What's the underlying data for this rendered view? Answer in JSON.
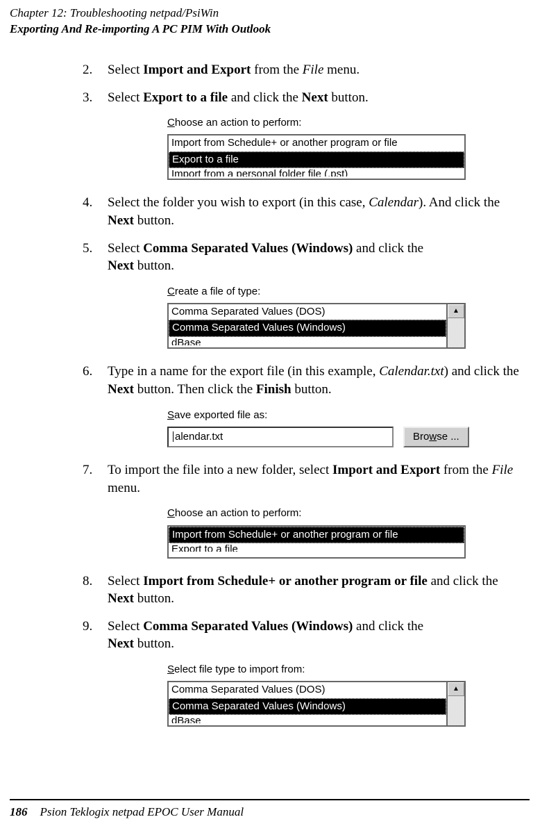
{
  "header": {
    "chapter": "Chapter 12:  Troubleshooting netpad/PsiWin",
    "section": "Exporting And Re-importing A PC PIM With Outlook"
  },
  "steps": {
    "s2": {
      "num": "2.",
      "pre": "Select ",
      "b1": "Import and Export",
      "mid": " from the ",
      "i1": "File",
      "post": " menu."
    },
    "s3": {
      "num": "3.",
      "pre": "Select ",
      "b1": "Export to a file",
      "mid": " and click the ",
      "b2": "Next",
      "post": " button."
    },
    "s4": {
      "num": "4.",
      "pre": "Select the folder you wish to export (in this case, ",
      "i1": "Calendar",
      "mid": "). And click the ",
      "b1": "Next",
      "post": " button."
    },
    "s5": {
      "num": "5.",
      "pre": "Select ",
      "b1": "Comma Separated Values (Windows)",
      "mid": " and click the ",
      "b2": "Next",
      "post": " button."
    },
    "s6": {
      "num": "6.",
      "pre": "Type in a name for the export file (in this example, ",
      "i1": "Calendar.txt",
      "mid": ") and click the ",
      "b1": "Next",
      "mid2": " button. Then click the ",
      "b2": "Finish",
      "post": " button."
    },
    "s7": {
      "num": "7.",
      "pre": "To import the file into a new folder, select ",
      "b1": "Import and Export",
      "mid": " from the ",
      "i1": "File",
      "post": " menu."
    },
    "s8": {
      "num": "8.",
      "pre": "Select ",
      "b1": "Import from Schedule+ or another program or file",
      "mid": " and click the ",
      "b2": "Next",
      "post": " button."
    },
    "s9": {
      "num": "9.",
      "pre": "Select ",
      "b1": "Comma Separated Values (Windows)",
      "mid": " and click the ",
      "b2": "Next",
      "post": " button."
    }
  },
  "fig1": {
    "label_u": "C",
    "label_rest": "hoose an action to perform:",
    "item1": "Import from Schedule+ or another program or file",
    "item2": "Export to a file",
    "item3": "Import from a personal folder file (.pst)"
  },
  "fig2": {
    "label_u": "C",
    "label_rest": "reate a file of type:",
    "item1": "Comma Separated Values (DOS)",
    "item2": "Comma Separated Values (Windows)",
    "item3": "dBase"
  },
  "fig3": {
    "label_u": "S",
    "label_rest": "ave exported file as:",
    "value": "alendar.txt",
    "browse": "Browse ...",
    "browse_u": "w"
  },
  "fig4": {
    "label_u": "C",
    "label_rest": "hoose an action to perform:",
    "item1": "Import from Schedule+ or another program or file",
    "item2": "Export to a file"
  },
  "fig5": {
    "label_u": "S",
    "label_rest": "elect file type to import from:",
    "item1": "Comma Separated Values (DOS)",
    "item2": "Comma Separated Values (Windows)",
    "item3": "dBase"
  },
  "footer": {
    "page": "186",
    "book": "Psion Teklogix netpad EPOC User Manual"
  },
  "glyphs": {
    "up": "▲"
  }
}
